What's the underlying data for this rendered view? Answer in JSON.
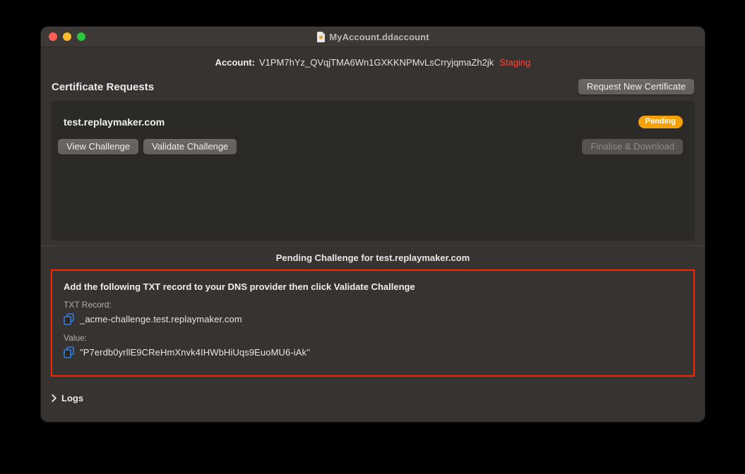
{
  "window": {
    "title": "MyAccount.ddaccount"
  },
  "account": {
    "label": "Account:",
    "id": "V1PM7hYz_QVqjTMA6Wn1GXKKNPMvLsCrryjqmaZh2jk",
    "environment": "Staging"
  },
  "certificate_requests": {
    "heading": "Certificate Requests",
    "request_new_button": "Request New Certificate",
    "requests": [
      {
        "domain": "test.replaymaker.com",
        "status": "Pending",
        "view_challenge_button": "View Challenge",
        "validate_challenge_button": "Validate Challenge",
        "finalise_download_button": "Finalise & Download"
      }
    ]
  },
  "challenge": {
    "heading": "Pending Challenge for test.replaymaker.com",
    "instructions": "Add the following TXT record to your DNS provider then click Validate Challenge",
    "txt_record_label": "TXT Record:",
    "txt_record": "_acme-challenge.test.replaymaker.com",
    "value_label": "Value:",
    "value": "\"P7erdb0yrllE9CReHmXnvk4IHWbHiUqs9EuoMU6-iAk\""
  },
  "logs": {
    "label": "Logs"
  },
  "colors": {
    "accent_red": "#ff453a",
    "pending_badge": "#f5a10c",
    "challenge_border": "#ff2600",
    "copy_icon_blue": "#2d7ff0"
  }
}
